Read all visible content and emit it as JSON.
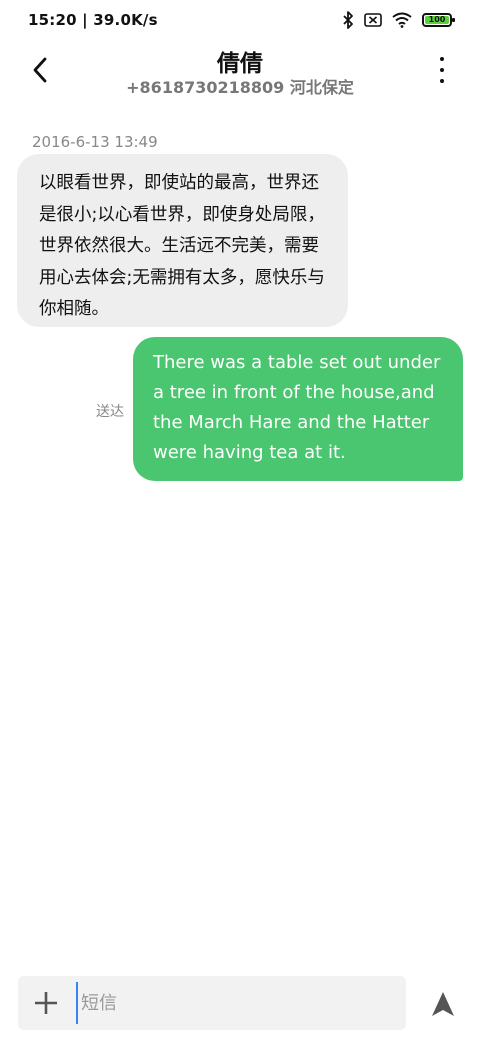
{
  "status_bar": {
    "time_speed": "15:20 | 39.0K/s",
    "battery_level": "100",
    "icons": [
      "bluetooth-icon",
      "sim-off-icon",
      "wifi-icon",
      "battery-icon"
    ]
  },
  "header": {
    "contact_name": "倩倩",
    "contact_subtitle": "+8618730218809 河北保定",
    "icons": [
      "back-arrow-icon",
      "more-vertical-icon"
    ]
  },
  "conversation": {
    "date": "2016-6-13 13:49",
    "incoming_message": "以眼看世界，即使站的最高，世界还是很小;以心看世界，即使身处局限，世界依然很大。生活远不完美，需要用心去体会;无需拥有太多，愿快乐与你相随。",
    "outgoing_message": "There was a table set out under a tree in front of the house,and the March Hare and the Hatter were having tea at it.",
    "delivered_label": "送达"
  },
  "composer": {
    "placeholder": "短信",
    "value": "",
    "icons": [
      "plus-icon",
      "send-icon"
    ]
  },
  "colors": {
    "outgoing_bubble": "#49c66f",
    "incoming_bubble": "#eeeeee",
    "battery_fill": "#5bd13a"
  }
}
